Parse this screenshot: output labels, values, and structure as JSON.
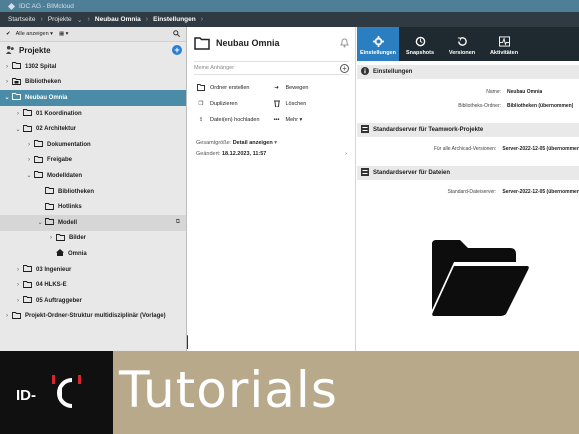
{
  "window": {
    "title": "IDC AG - BIMcloud"
  },
  "breadcrumb": [
    "Startseite",
    "Projekte",
    "Neubau Omnia",
    "Einstellungen"
  ],
  "sidebar": {
    "toolbar": {
      "filter_label": "Alle anzeigen"
    },
    "title": "Projekte",
    "items": [
      {
        "label": "1302 Spital",
        "level": 0,
        "expand": "collapsed",
        "icon": "folder"
      },
      {
        "label": "Bibliotheken",
        "level": 0,
        "expand": "collapsed",
        "icon": "library"
      },
      {
        "label": "Neubau Omnia",
        "level": 0,
        "expand": "expanded",
        "icon": "folder",
        "selected": true
      },
      {
        "label": "01 Koordination",
        "level": 1,
        "expand": "collapsed",
        "icon": "folder"
      },
      {
        "label": "02 Architektur",
        "level": 1,
        "expand": "expanded",
        "icon": "folder"
      },
      {
        "label": "Dokumentation",
        "level": 2,
        "expand": "collapsed",
        "icon": "folder"
      },
      {
        "label": "Freigabe",
        "level": 2,
        "expand": "collapsed",
        "icon": "folder"
      },
      {
        "label": "Modelldaten",
        "level": 2,
        "expand": "expanded",
        "icon": "folder"
      },
      {
        "label": "Bibliotheken",
        "level": 3,
        "expand": "none",
        "icon": "folder"
      },
      {
        "label": "Hotlinks",
        "level": 3,
        "expand": "none",
        "icon": "folder"
      },
      {
        "label": "Modell",
        "level": 3,
        "expand": "expanded",
        "icon": "folder",
        "hover": true
      },
      {
        "label": "Bilder",
        "level": 4,
        "expand": "collapsed",
        "icon": "folder"
      },
      {
        "label": "Omnia",
        "level": 4,
        "expand": "none",
        "icon": "house"
      },
      {
        "label": "03 Ingenieur",
        "level": 1,
        "expand": "collapsed",
        "icon": "folder"
      },
      {
        "label": "04 HLKS-E",
        "level": 1,
        "expand": "collapsed",
        "icon": "folder"
      },
      {
        "label": "05 Auftraggeber",
        "level": 1,
        "expand": "collapsed",
        "icon": "folder"
      },
      {
        "label": "Projekt-Ordner-Struktur multidisziplinär (Vorlage)",
        "level": 0,
        "expand": "collapsed",
        "icon": "folder"
      }
    ]
  },
  "middle": {
    "title": "Neubau Omnia",
    "note_placeholder": "Meine Anhänger",
    "actions": [
      {
        "label": "Ordner erstellen",
        "icon": "folder-icon"
      },
      {
        "label": "Bewegen",
        "icon": "move-icon"
      },
      {
        "label": "Duplizieren",
        "icon": "duplicate-icon"
      },
      {
        "label": "Löschen",
        "icon": "trash-icon"
      },
      {
        "label": "Datei(en) hochladen",
        "icon": "upload-icon"
      },
      {
        "label": "Mehr",
        "icon": "more-icon"
      }
    ],
    "size_label": "Gesamtgröße:",
    "size_value": "Detail anzeigen",
    "changed_label": "Geändert:",
    "changed_value": "18.12.2023, 11:57"
  },
  "tabs": [
    {
      "label": "Einstellungen",
      "icon": "gear-icon",
      "active": true
    },
    {
      "label": "Snapshots",
      "icon": "snapshot-icon",
      "active": false
    },
    {
      "label": "Versionen",
      "icon": "history-icon",
      "active": false
    },
    {
      "label": "Aktivitäten",
      "icon": "activity-icon",
      "active": false
    }
  ],
  "settings": {
    "section1": {
      "title": "Einstellungen",
      "rows": [
        {
          "k": "Name:",
          "v": "Neubau Omnia"
        },
        {
          "k": "Bibliotheks-Ordner:",
          "v": "Bibliotheken (übernommen)"
        }
      ]
    },
    "section2": {
      "title": "Standardserver für Teamwork-Projekte",
      "rows": [
        {
          "k": "Für alle Archicad-Versionen:",
          "v": "Server-2022-12-05 (übernommen)"
        }
      ]
    },
    "section3": {
      "title": "Standardserver für Dateien",
      "rows": [
        {
          "k": "Standard-Dateiserver:",
          "v": "Server-2022-12-05 (übernommen)"
        }
      ]
    }
  },
  "footer": {
    "text": "Tutorials",
    "logo_text": "ID-C"
  },
  "colors": {
    "accent": "#2b7fc1",
    "selected": "#4a8ca8",
    "footer_tan": "#b8a98a",
    "footer_black": "#101010",
    "titlebar": "#4f7f96"
  }
}
